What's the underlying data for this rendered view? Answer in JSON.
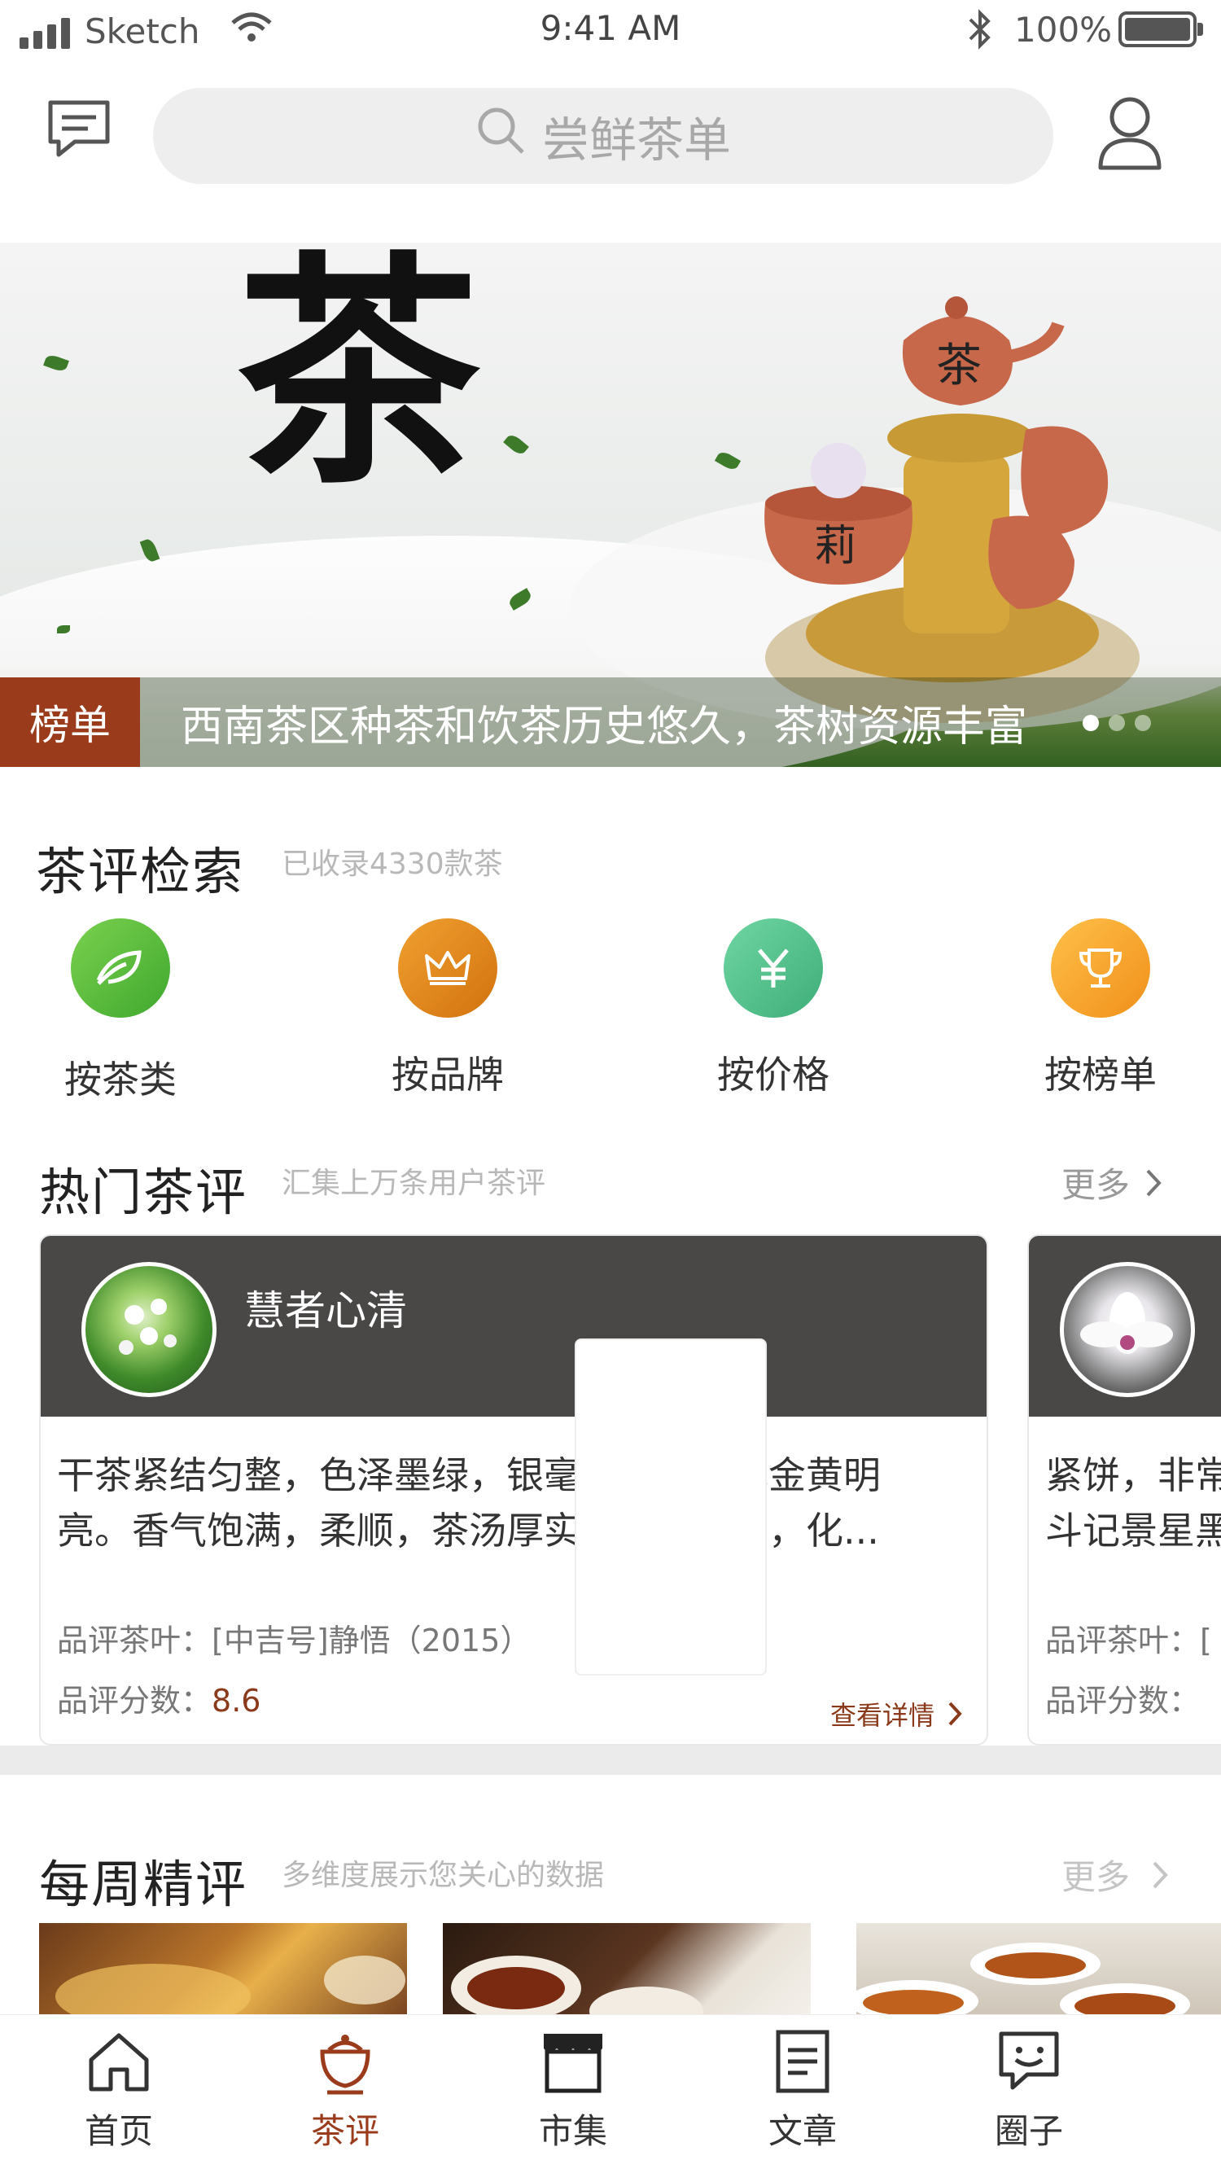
{
  "status_bar": {
    "carrier": "Sketch",
    "time": "9:41 AM",
    "battery": "100%"
  },
  "header": {
    "search_placeholder": "尝鲜茶单"
  },
  "banner": {
    "big_char": "茶",
    "tag": "榜单",
    "caption": "西南茶区种茶和饮茶历史悠久，茶树资源丰富",
    "page_count": 3,
    "active_page": 1
  },
  "tea_search": {
    "title": "茶评检索",
    "subtitle": "已收录4330款茶",
    "categories": [
      {
        "label": "按茶类",
        "icon": "leaf-icon",
        "color": "#5cb93f"
      },
      {
        "label": "按品牌",
        "icon": "crown-icon",
        "color": "#e08a1e"
      },
      {
        "label": "按价格",
        "icon": "yen-icon",
        "color": "#4fbf8c"
      },
      {
        "label": "按榜单",
        "icon": "trophy-icon",
        "color": "#f5a623"
      }
    ]
  },
  "hot_reviews": {
    "title": "热门茶评",
    "subtitle": "汇集上万条用户茶评",
    "more": "更多",
    "cards": [
      {
        "user": "慧者心清",
        "text": "干茶紧结匀整，色泽墨绿，银毫显露。汤色金黄明亮。香气饱满，柔顺，茶汤厚实，入口较苦，化...",
        "tea_label": "品评茶叶：",
        "tea_name": "[中吉号]静悟（2015）",
        "score_label": "品评分数：",
        "score": "8.6",
        "detail_link": "查看详情"
      },
      {
        "user": "",
        "text": "紧饼，非常\n斗记景星黑",
        "tea_label": "品评茶叶：",
        "tea_name": "[",
        "score_label": "品评分数：",
        "score": ""
      }
    ]
  },
  "weekly": {
    "title": "每周精评",
    "subtitle": "多维度展示您关心的数据",
    "more": "更多"
  },
  "tab_bar": {
    "tabs": [
      {
        "label": "首页",
        "icon": "home-icon"
      },
      {
        "label": "茶评",
        "icon": "tea-cup-icon",
        "active": true
      },
      {
        "label": "市集",
        "icon": "store-icon"
      },
      {
        "label": "文章",
        "icon": "article-icon"
      },
      {
        "label": "圈子",
        "icon": "chat-bubble-icon"
      }
    ],
    "accent_color": "#9a3c1c"
  }
}
